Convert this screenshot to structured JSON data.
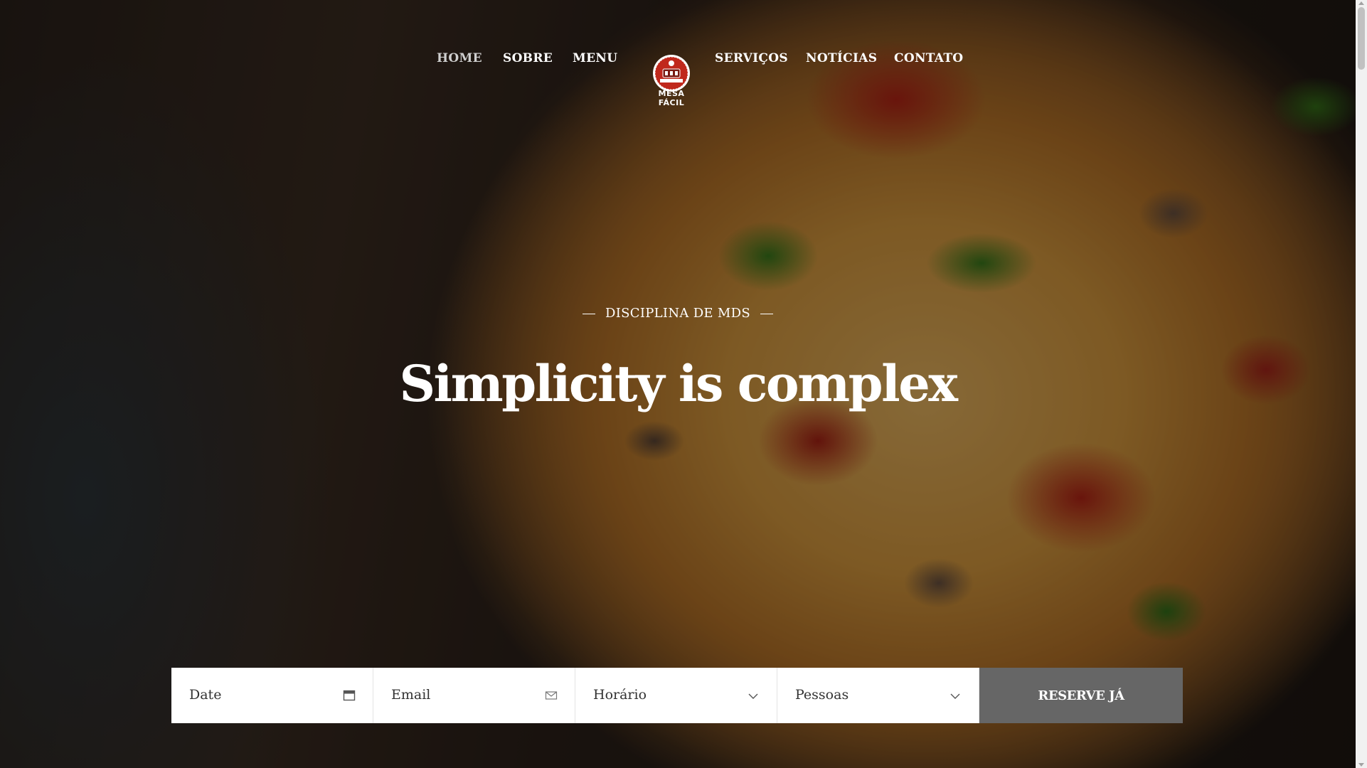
{
  "nav": {
    "items": [
      {
        "label": "HOME",
        "active": true
      },
      {
        "label": "SOBRE",
        "active": false
      },
      {
        "label": "MENU",
        "active": false
      },
      {
        "label": "SERVIÇOS",
        "active": false
      },
      {
        "label": "NOTÍCIAS",
        "active": false
      },
      {
        "label": "CONTATO",
        "active": false
      }
    ],
    "logo_text": "MESA FÁCIL"
  },
  "hero": {
    "subtitle": "DISCIPLINA DE MDS",
    "headline": "Simplicity is complex"
  },
  "booking": {
    "date_placeholder": "Date",
    "email_placeholder": "Email",
    "time_label": "Horário",
    "people_label": "Pessoas",
    "submit_label": "RESERVE JÁ"
  },
  "colors": {
    "button_bg": "#666666",
    "overlay": "rgba(0,0,0,0.42)",
    "text": "#ffffff",
    "logo_red": "#c0281c"
  },
  "icons": {
    "date": "calendar-icon",
    "email": "envelope-icon",
    "time": "chevron-down-icon",
    "people": "chevron-down-icon"
  }
}
